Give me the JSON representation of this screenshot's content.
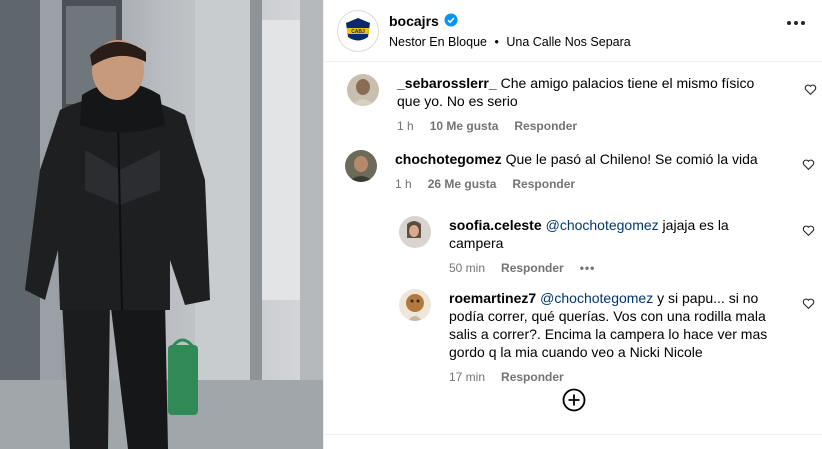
{
  "post": {
    "author": "bocajrs",
    "music_artist": "Nestor En Bloque",
    "music_separator": "•",
    "music_song": "Una Calle Nos Separa"
  },
  "comments": [
    {
      "user": "_sebarosslerr_",
      "text": "Che amigo palacios tiene el mismo físico que yo. No es serio",
      "time": "1 h",
      "likes": "10 Me gusta",
      "reply": "Responder"
    },
    {
      "user": "chochotegomez",
      "text": "Que le pasó al Chileno! Se comió la vida",
      "time": "1 h",
      "likes": "26 Me gusta",
      "reply": "Responder"
    }
  ],
  "replies": [
    {
      "user": "soofia.celeste",
      "mention": "@chochotegomez",
      "text": " jajaja es la campera",
      "time": "50 min",
      "reply": "Responder",
      "more": "•••"
    },
    {
      "user": "roemartinez7",
      "mention": "@chochotegomez",
      "text": " y si papu... si no podía correr, qué querías. Vos con una rodilla mala salis a correr?. Encima la campera lo hace ver mas gordo q la mia cuando veo a Nicki Nicole",
      "time": "17 min",
      "reply": "Responder"
    }
  ],
  "colors": {
    "mention": "#00376b",
    "meta": "#737373",
    "verified": "#0095f6"
  },
  "icons": {
    "more": "more-options-icon",
    "heart": "heart-outline-icon",
    "load_more": "plus-circle-icon",
    "verified": "verified-badge-icon"
  }
}
